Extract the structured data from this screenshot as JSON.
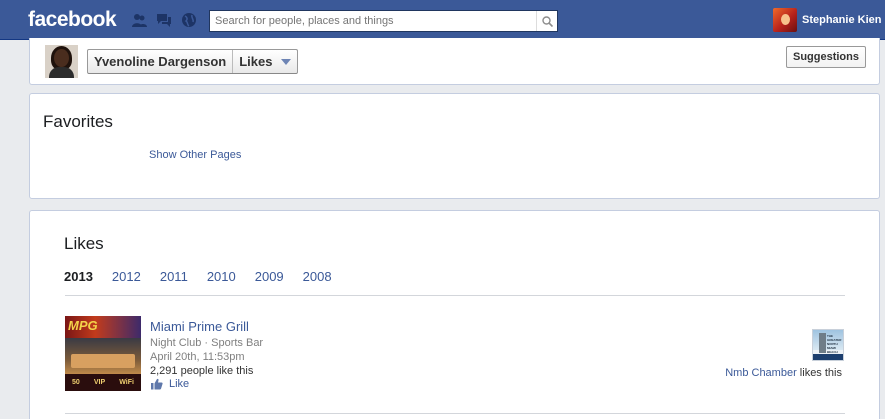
{
  "topbar": {
    "logo": "facebook",
    "jewels": [
      "friends-icon",
      "messages-icon",
      "notifications-globe-icon"
    ],
    "search": {
      "placeholder": "Search for people, places and things",
      "icon": "search-icon"
    },
    "user": {
      "name": "Stephanie Kien"
    }
  },
  "header": {
    "profile_name": "Yvenoline Dargenson",
    "section": "Likes",
    "suggestions_label": "Suggestions"
  },
  "favorites": {
    "title": "Favorites",
    "show_other": "Show Other Pages"
  },
  "likes": {
    "title": "Likes",
    "years": [
      {
        "label": "2013",
        "active": true
      },
      {
        "label": "2012",
        "active": false
      },
      {
        "label": "2011",
        "active": false
      },
      {
        "label": "2010",
        "active": false
      },
      {
        "label": "2009",
        "active": false
      },
      {
        "label": "2008",
        "active": false
      }
    ],
    "items": [
      {
        "name": "Miami Prime Grill",
        "image_text": "MPG",
        "image_badges": [
          "50",
          "VIP",
          "WiFi"
        ],
        "category": "Night Club · Sports Bar",
        "date": "April 20th, 11:53pm",
        "count": "2,291 people like this",
        "like_label": "Like",
        "friend_image_text": "THE GREATER NORTH MIAMI BEACH",
        "friend_link": "Nmb Chamber",
        "friend_suffix": " likes this"
      }
    ]
  },
  "colors": {
    "brand": "#3b5998",
    "link": "#3b5998",
    "background": "#e9ebee"
  }
}
